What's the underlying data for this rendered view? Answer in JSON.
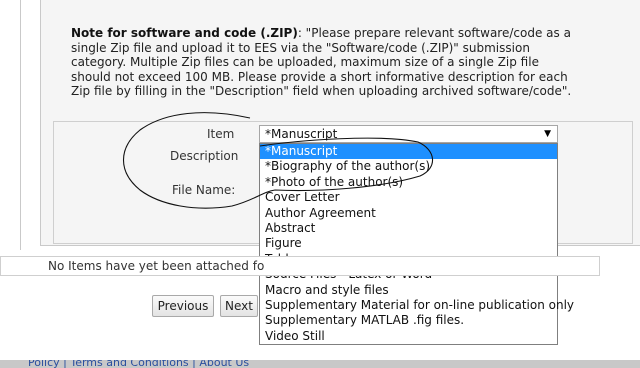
{
  "note": {
    "heading": "Note for software and code (.ZIP)",
    "line1": ": \"Please prepare relevant software/code as a",
    "line2": "single Zip file and upload it to EES via the \"Software/code (.ZIP)\" submission",
    "line3": "category. Multiple Zip files can be uploaded, maximum size of a single Zip file",
    "line4": "should not exceed 100 MB. Please provide a short informative description for each",
    "line5": "Zip file by filling in the \"Description\" field when uploading archived software/code\"."
  },
  "form": {
    "item_label": "Item",
    "description_label": "Description",
    "file_name_label": "File Name:",
    "selected_item": "*Manuscript",
    "options": [
      "*Manuscript",
      "*Biography of the author(s)",
      "*Photo of the author(s)",
      "Cover Letter",
      "Author Agreement",
      "Abstract",
      "Figure",
      "Table",
      "Source Files - Latex or Word",
      "Macro and style files",
      "Supplementary Material for on-line publication only",
      "Supplementary MATLAB .fig files.",
      "Video Still"
    ]
  },
  "attachments": {
    "empty_text": "No Items have yet been attached fo"
  },
  "nav": {
    "previous": "Previous",
    "next": "Next"
  },
  "footer": {
    "links": "Policy  |  Terms and Conditions  |  About Us"
  }
}
